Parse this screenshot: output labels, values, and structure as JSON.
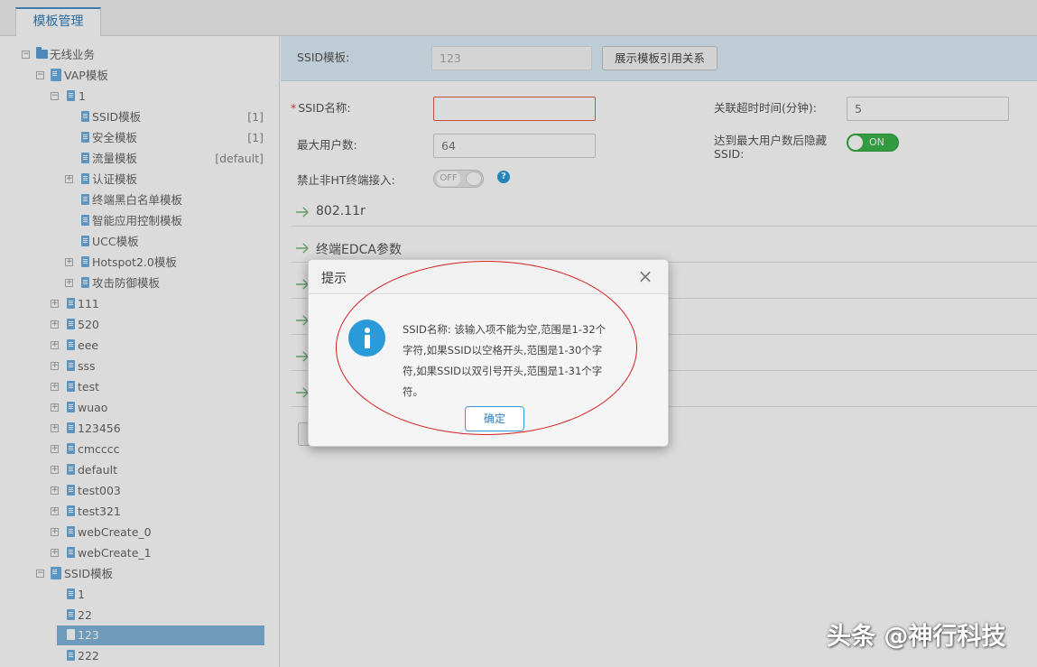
{
  "app": {
    "tab_label": "模板管理"
  },
  "tree": {
    "root": "无线业务",
    "vap": "VAP模板",
    "vap_child": "1",
    "templates": [
      {
        "label": "SSID模板",
        "badge": "[1]"
      },
      {
        "label": "安全模板",
        "badge": "[1]"
      },
      {
        "label": "流量模板",
        "badge": "[default]"
      },
      {
        "label": "认证模板",
        "badge": ""
      },
      {
        "label": "终端黑白名单模板",
        "badge": ""
      },
      {
        "label": "智能应用控制模板",
        "badge": ""
      },
      {
        "label": "UCC模板",
        "badge": ""
      },
      {
        "label": "Hotspot2.0模板",
        "badge": ""
      },
      {
        "label": "攻击防御模板",
        "badge": ""
      }
    ],
    "vap_items": [
      "111",
      "520",
      "eee",
      "sss",
      "test",
      "wuao",
      "123456",
      "cmcccc",
      "default",
      "test003",
      "test321",
      "webCreate_0",
      "webCreate_1"
    ],
    "ssid_group": "SSID模板",
    "ssid_items": [
      "1",
      "22",
      "123",
      "222"
    ],
    "selected": "123"
  },
  "form": {
    "ssid_template_label": "SSID模板:",
    "ssid_template_value": "123",
    "show_ref_button": "展示模板引用关系",
    "ssid_name_label": "SSID名称:",
    "ssid_name_value": "",
    "timeout_label": "关联超时时间(分钟):",
    "timeout_value": "5",
    "max_users_label": "最大用户数:",
    "max_users_value": "64",
    "hide_ssid_label_line1": "达到最大用户数后隐藏",
    "hide_ssid_label_line2": "SSID:",
    "hide_ssid_toggle": "ON",
    "non_ht_label": "禁止非HT终端接入:",
    "non_ht_toggle": "OFF",
    "help_icon": "?"
  },
  "sections": [
    "802.11r",
    "终端EDCA参数"
  ],
  "dialog": {
    "title": "提示",
    "close": "×",
    "info_icon": "info-icon",
    "message": "SSID名称: 该输入项不能为空,范围是1-32个字符,如果SSID以空格开头,范围是1-30个字符,如果SSID以双引号开头,范围是1-31个字符。",
    "ok_button": "确定"
  },
  "watermark": "头条 @神行科技",
  "colors": {
    "accent": "#2a9bd8",
    "toggle_on": "#3bb54a",
    "highlight_ellipse": "#d62020",
    "selected_row": "#7fb5d8"
  }
}
